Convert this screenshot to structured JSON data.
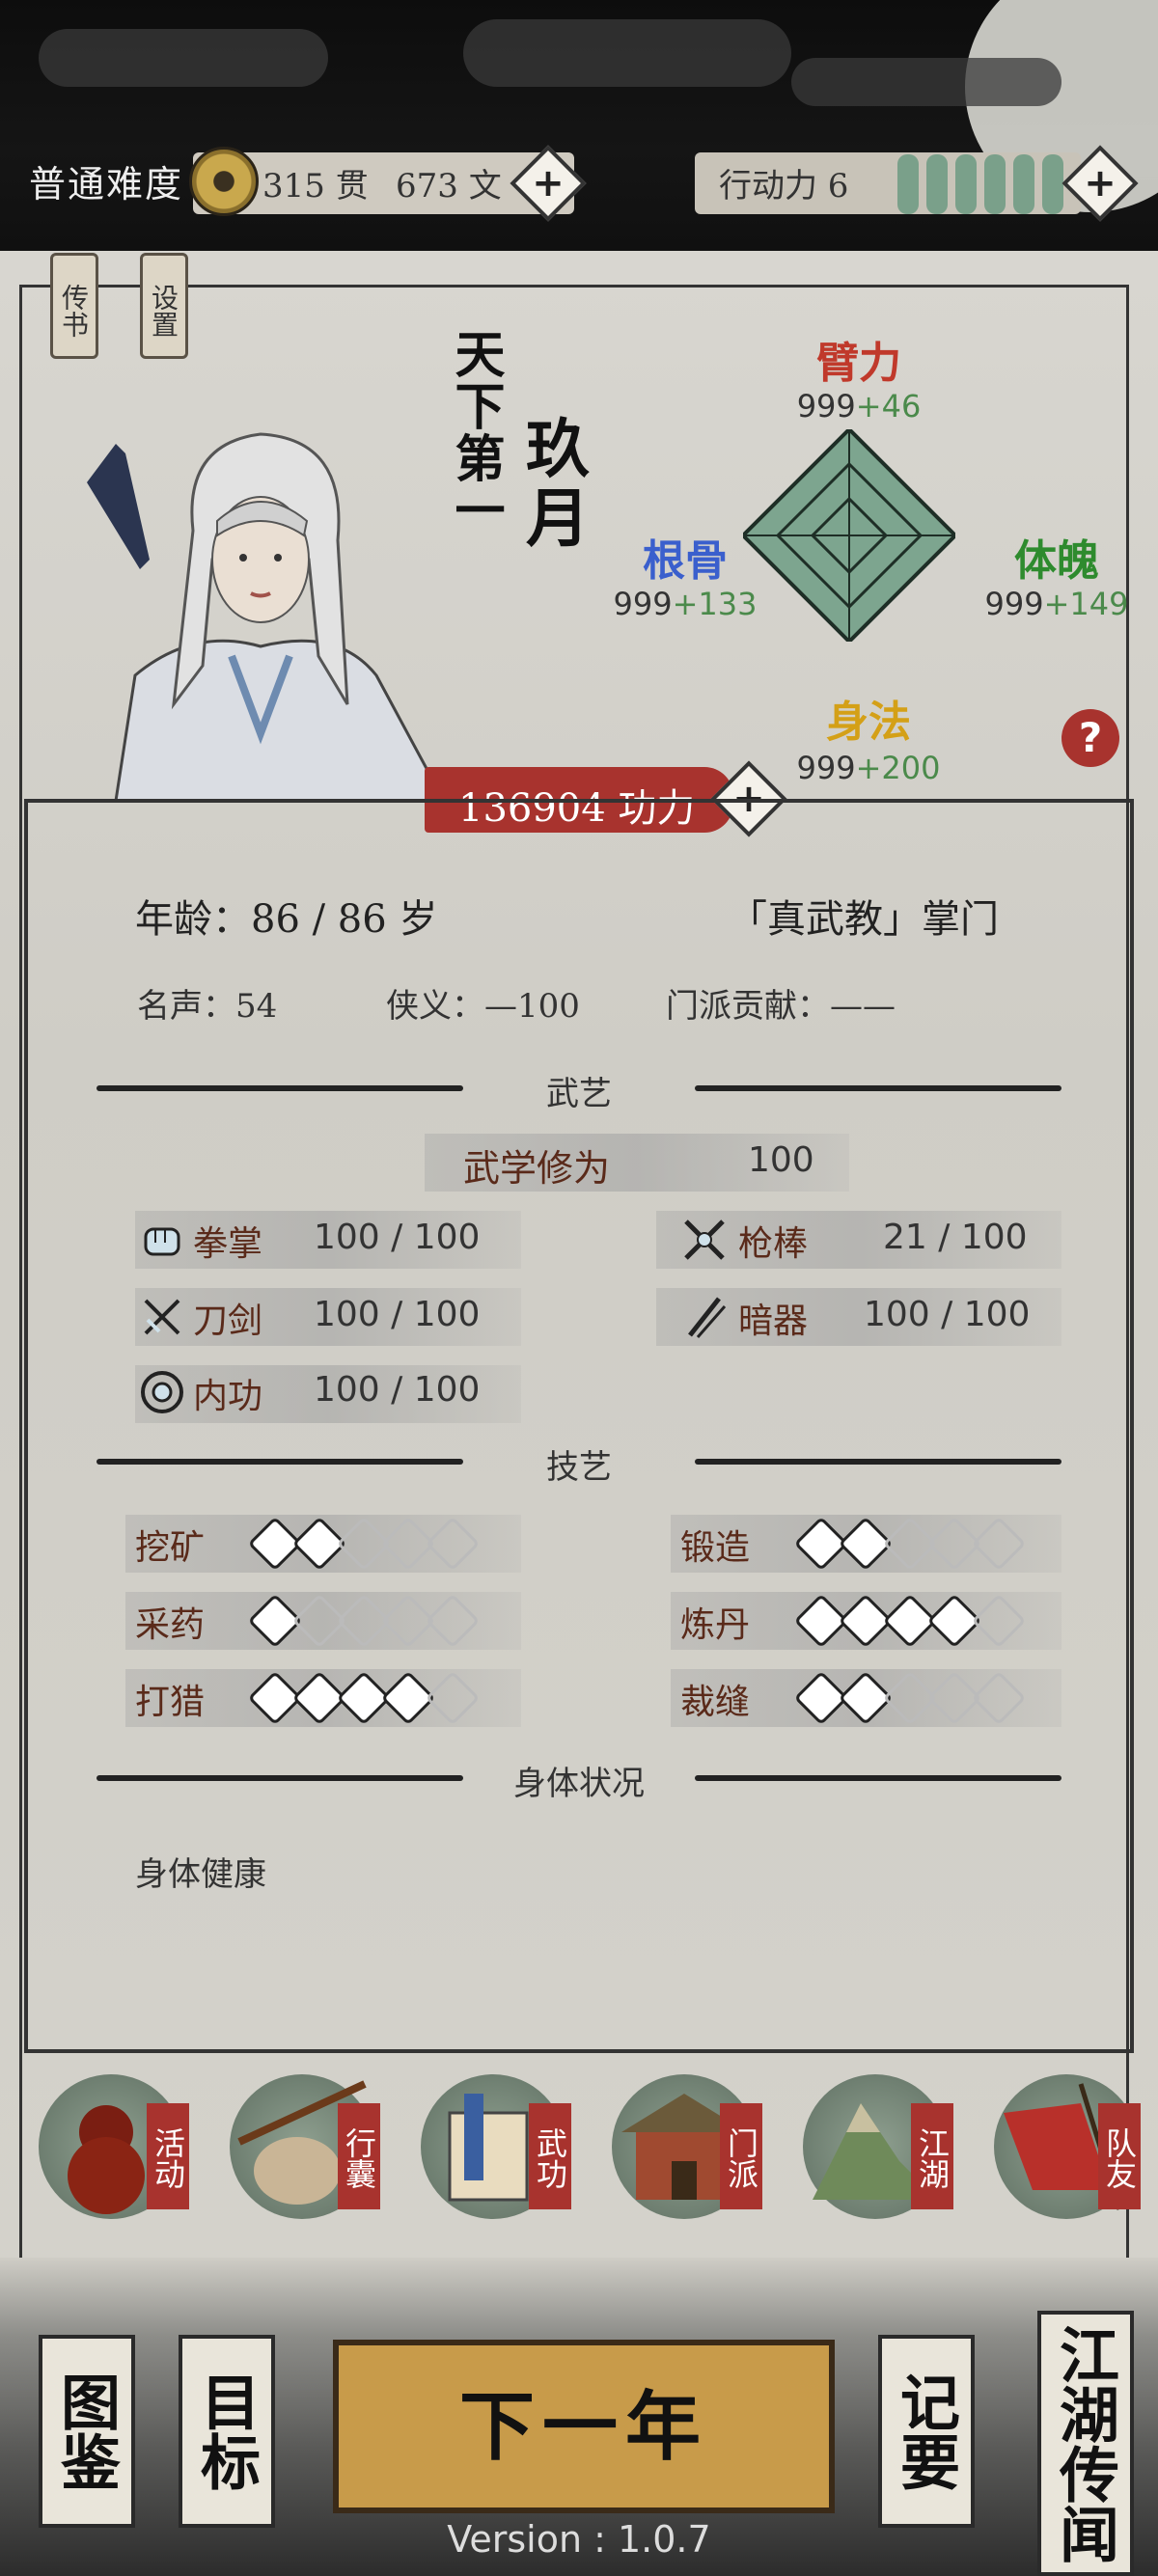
{
  "header": {
    "difficulty": "普通难度",
    "money_guan": "315 贯",
    "money_wen": "673 文",
    "action_label": "行动力 6",
    "action_points": 6
  },
  "tags": [
    "传书",
    "设置"
  ],
  "character": {
    "title": "天下第一",
    "name": "玖月",
    "power_value": "136904",
    "power_label": "功力"
  },
  "attributes": {
    "strength": {
      "label": "臂力",
      "base": "999",
      "bonus": "+46",
      "color": "#c0392b"
    },
    "physique": {
      "label": "体魄",
      "base": "999",
      "bonus": "+149",
      "color": "#2e8b2e"
    },
    "agility": {
      "label": "身法",
      "base": "999",
      "bonus": "+200",
      "color": "#d4a017"
    },
    "root": {
      "label": "根骨",
      "base": "999",
      "bonus": "+133",
      "color": "#3a5fcd"
    }
  },
  "info": {
    "age": "年龄：86 / 86 岁",
    "sect_role": "「真武教」掌门",
    "fame": "名声：54",
    "chivalry": "侠义：—100",
    "contribution": "门派贡献：——"
  },
  "martial": {
    "section": "武艺",
    "cultivation_label": "武学修为",
    "cultivation_value": "100",
    "skills": [
      {
        "label": "拳掌",
        "value": "100 / 100",
        "icon": "fist-icon"
      },
      {
        "label": "枪棒",
        "value": "21 / 100",
        "icon": "spear-icon"
      },
      {
        "label": "刀剑",
        "value": "100 / 100",
        "icon": "sword-icon"
      },
      {
        "label": "暗器",
        "value": "100 / 100",
        "icon": "dart-icon"
      },
      {
        "label": "内功",
        "value": "100 / 100",
        "icon": "inner-power-icon"
      }
    ]
  },
  "crafts": {
    "section": "技艺",
    "items": [
      {
        "label": "挖矿",
        "level": 2,
        "max": 5,
        "icon": "pickaxe-icon"
      },
      {
        "label": "锻造",
        "level": 2,
        "max": 5,
        "icon": "anvil-icon"
      },
      {
        "label": "采药",
        "level": 1,
        "max": 5,
        "icon": "herb-icon"
      },
      {
        "label": "炼丹",
        "level": 4,
        "max": 5,
        "icon": "bowl-icon"
      },
      {
        "label": "打猎",
        "level": 4,
        "max": 5,
        "icon": "bow-icon"
      },
      {
        "label": "裁缝",
        "level": 2,
        "max": 5,
        "icon": "needle-icon"
      }
    ]
  },
  "health": {
    "section": "身体状况",
    "status": "身体健康"
  },
  "nav": [
    {
      "label": "活动",
      "icon": "gourd-icon"
    },
    {
      "label": "行囊",
      "icon": "bag-icon"
    },
    {
      "label": "武功",
      "icon": "scroll-icon"
    },
    {
      "label": "门派",
      "icon": "temple-icon"
    },
    {
      "label": "江湖",
      "icon": "mountain-icon"
    },
    {
      "label": "队友",
      "icon": "banner-icon"
    }
  ],
  "bottom": {
    "atlas": "图鉴",
    "goals": "目标",
    "next_year": "下一年",
    "notes": "记要",
    "rumors": "江湖传闻",
    "version": "Version : 1.0.7"
  }
}
